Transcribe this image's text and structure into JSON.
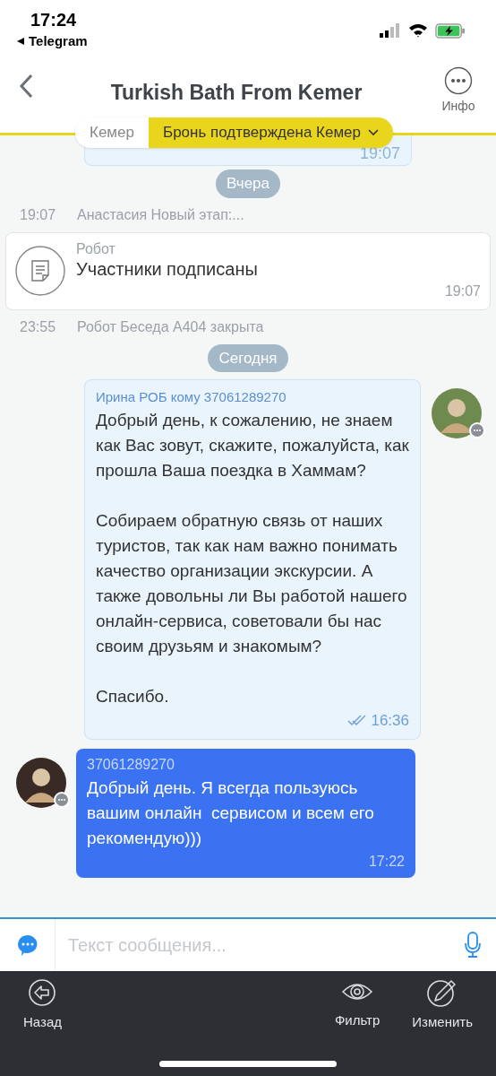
{
  "status_bar": {
    "time": "17:24",
    "back_app": "Telegram"
  },
  "header": {
    "title": "Turkish Bath From Kemer",
    "info_label": "Инфо"
  },
  "tabs": [
    {
      "label": "Кемер",
      "selected": false
    },
    {
      "label": "Бронь подтверждена Кемер",
      "selected": true
    }
  ],
  "messages": [
    {
      "kind": "partial",
      "time": "19:07"
    },
    {
      "kind": "date",
      "text": "Вчера"
    },
    {
      "kind": "event",
      "time": "19:07",
      "text": "Анастасия Новый этап:..."
    },
    {
      "kind": "robot",
      "sender": "Робот",
      "text": "Участники подписаны",
      "time": "19:07"
    },
    {
      "kind": "event",
      "time": "23:55",
      "text": "Робот Беседа А404 закрыта"
    },
    {
      "kind": "date",
      "text": "Сегодня"
    },
    {
      "kind": "incoming",
      "sender": "Ирина РОБ кому 37061289270",
      "text": "Добрый день, к сожалению, не знаем как Вас зовут, скажите, пожалуйста, как прошла Ваша поездка в Хаммам?\n\nСобираем обратную связь от наших туристов, так как нам важно понимать качество организации экскурсии. А также довольны ли Вы работой нашего онлайн-сервиса, советовали бы нас своим друзьям и знакомым?\n\nСпасибо.",
      "time": "16:36",
      "read": true
    },
    {
      "kind": "outgoing",
      "sender": "37061289270",
      "text": "Добрый день. Я всегда пользуюсь вашим онлайн  сервисом и всем его рекомендую)))",
      "time": "17:22"
    }
  ],
  "composer": {
    "placeholder": "Текст сообщения..."
  },
  "toolbar": [
    {
      "label": "Назад"
    },
    {
      "label": "Фильтр"
    },
    {
      "label": "Изменить"
    }
  ]
}
